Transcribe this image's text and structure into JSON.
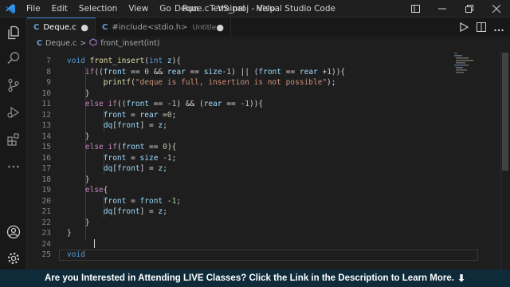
{
  "titlebar": {
    "menu": [
      "File",
      "Edit",
      "Selection",
      "View",
      "Go",
      "Run",
      "Terminal",
      "Help"
    ],
    "window_title": "Deque.c - VS_proj - Visual Studio Code",
    "icons": [
      "vscode-logo",
      "layout-icon",
      "minimize-icon",
      "restore-icon",
      "close-icon"
    ]
  },
  "activity_icons": [
    "explorer-icon",
    "search-icon",
    "source-control-icon",
    "run-debug-icon",
    "extensions-icon",
    "more-icon",
    "account-icon",
    "settings-gear-icon"
  ],
  "tabs": [
    {
      "lang": "C",
      "label": "Deque.c",
      "dirty": "●"
    },
    {
      "lang": "C",
      "label": "#include<stdio.h>",
      "sublabel": "Untitled-1",
      "dirty": "●"
    }
  ],
  "breadcrumb": {
    "lang": "C",
    "file": "Deque.c",
    "separator": ">",
    "symbol_icon": "function-icon",
    "symbol": "front_insert(int)"
  },
  "editor": {
    "lines": [
      {
        "n": "7",
        "t": "void front_insert(int z){"
      },
      {
        "n": "8",
        "t": "    if((front == 0 && rear == size-1) || (front == rear +1)){"
      },
      {
        "n": "9",
        "t": "        printf(\"deque is full, insertion is not possible\");"
      },
      {
        "n": "10",
        "t": "    }"
      },
      {
        "n": "11",
        "t": "    else if((front == -1) && (rear == -1)){"
      },
      {
        "n": "12",
        "t": "        front = rear =0;"
      },
      {
        "n": "13",
        "t": "        dq[front] = z;"
      },
      {
        "n": "14",
        "t": "    }"
      },
      {
        "n": "15",
        "t": "    else if(front == 0){"
      },
      {
        "n": "16",
        "t": "        front = size -1;"
      },
      {
        "n": "17",
        "t": "        dq[front] = z;"
      },
      {
        "n": "18",
        "t": "    }"
      },
      {
        "n": "19",
        "t": "    else{"
      },
      {
        "n": "20",
        "t": "        front = front -1;"
      },
      {
        "n": "21",
        "t": "        dq[front] = z;"
      },
      {
        "n": "22",
        "t": "    }"
      },
      {
        "n": "23",
        "t": "}"
      },
      {
        "n": "24",
        "t": ""
      },
      {
        "n": "25",
        "t": "void"
      }
    ],
    "current_line": "25"
  },
  "banner": {
    "text": "Are you Interested in Attending LIVE Classes? Click the Link in the Description to Learn More.",
    "arrow": "⬇"
  },
  "colors": {
    "editor_bg": "#1e1e1e",
    "keyword": "#569cd6",
    "control": "#c586c0",
    "function": "#dcdcaa",
    "number": "#b5cea8",
    "string": "#ce9178",
    "variable": "#9cdcfe",
    "banner_bg": "#0f2b3a",
    "accent": "#3a86d7"
  }
}
